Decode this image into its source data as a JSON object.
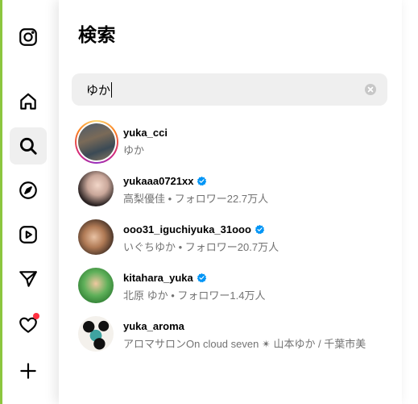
{
  "sidebar": {
    "items": [
      {
        "name": "instagram-logo",
        "icon": "instagram-icon"
      },
      {
        "name": "home",
        "icon": "home-icon"
      },
      {
        "name": "search",
        "icon": "search-icon",
        "active": true
      },
      {
        "name": "explore",
        "icon": "compass-icon"
      },
      {
        "name": "reels",
        "icon": "reels-icon"
      },
      {
        "name": "messages",
        "icon": "send-icon"
      },
      {
        "name": "notifications",
        "icon": "heart-icon",
        "has_dot": true
      },
      {
        "name": "create",
        "icon": "plus-icon"
      }
    ]
  },
  "search_panel": {
    "title": "検索",
    "query": "ゆか",
    "results": [
      {
        "username": "yuka_cci",
        "subtitle": "ゆか",
        "verified": false,
        "has_story": true
      },
      {
        "username": "yukaaa0721xx",
        "subtitle": "高梨優佳 • フォロワー22.7万人",
        "verified": true,
        "has_story": false
      },
      {
        "username": "ooo31_iguchiyuka_31ooo",
        "subtitle": "いぐちゆか • フォロワー20.7万人",
        "verified": true,
        "has_story": false
      },
      {
        "username": "kitahara_yuka",
        "subtitle": "北原 ゆか • フォロワー1.4万人",
        "verified": true,
        "has_story": false
      },
      {
        "username": "yuka_aroma",
        "subtitle": "アロマサロンOn cloud seven ✴ 山本ゆか / 千葉市美",
        "verified": false,
        "has_story": false
      }
    ]
  },
  "colors": {
    "verified_blue": "#0095f6",
    "notification_red": "#ff3040",
    "secondary_text": "#737373",
    "search_bg": "#efefef",
    "left_edge_green": "#8cc63f"
  }
}
